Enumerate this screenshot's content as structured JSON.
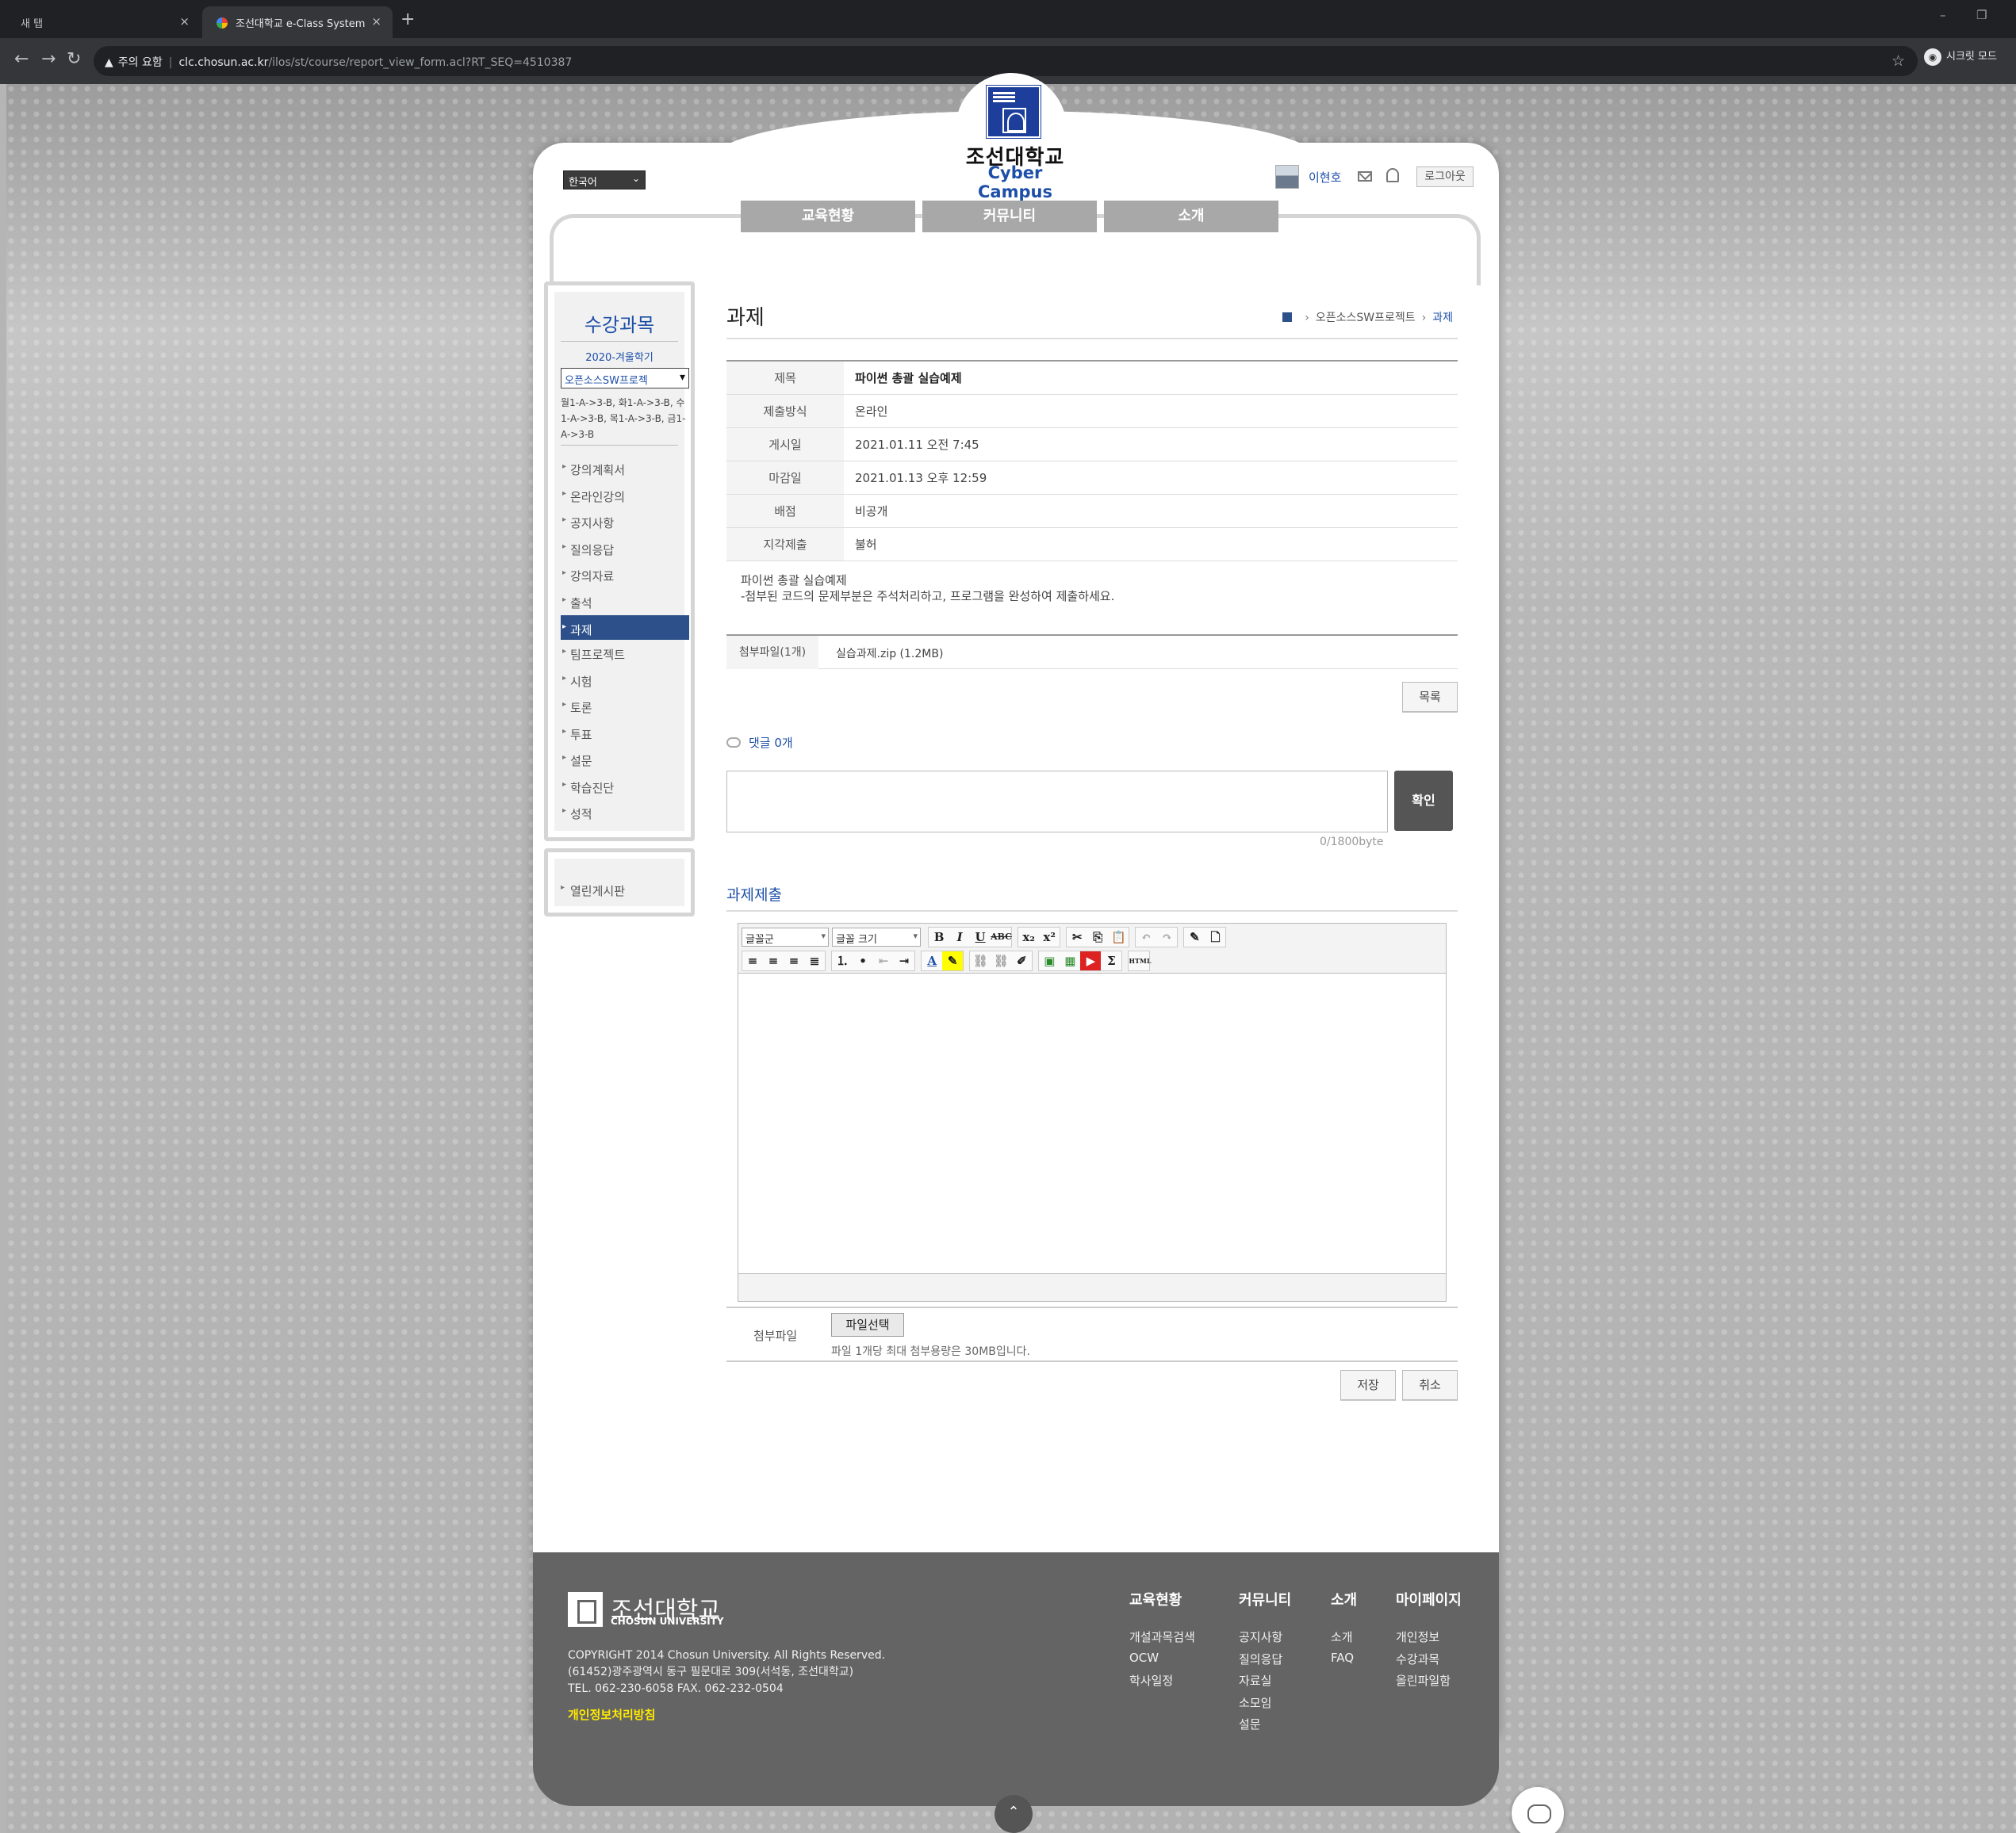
{
  "browser": {
    "tabs": [
      {
        "label": "새 탭"
      },
      {
        "label": "조선대학교 e-Class System"
      }
    ],
    "address": {
      "warning": "주의 요함",
      "host": "clc.chosun.ac.kr",
      "path": "/ilos/st/course/report_view_form.acl?RT_SEQ=4510387"
    },
    "incognito_label": "시크릿 모드"
  },
  "header": {
    "logo_ko": "조선대학교",
    "logo_en": "Cyber Campus",
    "language": "한국어",
    "user_name": "이현호",
    "logout": "로그아웃"
  },
  "gnb": [
    "교육현황",
    "커뮤니티",
    "소개"
  ],
  "sidebar": {
    "title": "수강과목",
    "term": "2020-겨울학기",
    "course_select": "오픈소스SW프로젝",
    "schedule": "월1-A->3-B, 화1-A->3-B, 수1-A->3-B, 목1-A->3-B, 금1-A->3-B",
    "menu": [
      "강의계획서",
      "온라인강의",
      "공지사항",
      "질의응답",
      "강의자료",
      "출석",
      "과제",
      "팀프로젝트",
      "시험",
      "토론",
      "투표",
      "설문",
      "학습진단",
      "성적"
    ],
    "active_index": 6,
    "extra": "열린게시판"
  },
  "content": {
    "title": "과제",
    "breadcrumb": [
      "오픈소스SW프로젝트",
      "과제"
    ],
    "info": [
      {
        "k": "제목",
        "v": "파이썬 총괄 실습예제"
      },
      {
        "k": "제출방식",
        "v": "온라인"
      },
      {
        "k": "게시일",
        "v": "2021.01.11 오전 7:45"
      },
      {
        "k": "마감일",
        "v": "2021.01.13 오후 12:59"
      },
      {
        "k": "배점",
        "v": "비공개"
      },
      {
        "k": "지각제출",
        "v": "불허"
      }
    ],
    "description": [
      "파이썬 총괄 실습예제",
      "-첨부된 코드의 문제부분은 주석처리하고, 프로그램을 완성하여 제출하세요."
    ],
    "attachment_label": "첨부파일(1개)",
    "attachment_file": "실습과제.zip (1.2MB)",
    "list_button": "목록",
    "comment_count": "댓글 0개",
    "comment_submit": "확인",
    "byte_counter": "0/1800byte",
    "submit_title": "과제제출",
    "editor": {
      "font_select": "글꼴군",
      "size_select": "글꼴 크기"
    },
    "file_label": "첨부파일",
    "file_pick": "파일선택",
    "file_note": "파일 1개당 최대 첨부용량은 30MB입니다.",
    "save_button": "저장",
    "cancel_button": "취소"
  },
  "footer": {
    "logo_ko": "조선대학교",
    "logo_en": "CHOSUN UNIVERSITY",
    "info": [
      "COPYRIGHT 2014 Chosun University. All Rights Reserved.",
      "(61452)광주광역시 동구 필문대로 309(서석동, 조선대학교)",
      "TEL. 062-230-6058 FAX. 062-232-0504"
    ],
    "privacy": "개인정보처리방침",
    "cols": [
      {
        "h": "교육현황",
        "items": [
          "개설과목검색",
          "OCW",
          "학사일정"
        ]
      },
      {
        "h": "커뮤니티",
        "items": [
          "공지사항",
          "질의응답",
          "자료실",
          "소모임",
          "설문"
        ]
      },
      {
        "h": "소개",
        "items": [
          "소개",
          "FAQ"
        ]
      },
      {
        "h": "마이페이지",
        "items": [
          "개인정보",
          "수강과목",
          "올린파일함"
        ]
      }
    ]
  }
}
